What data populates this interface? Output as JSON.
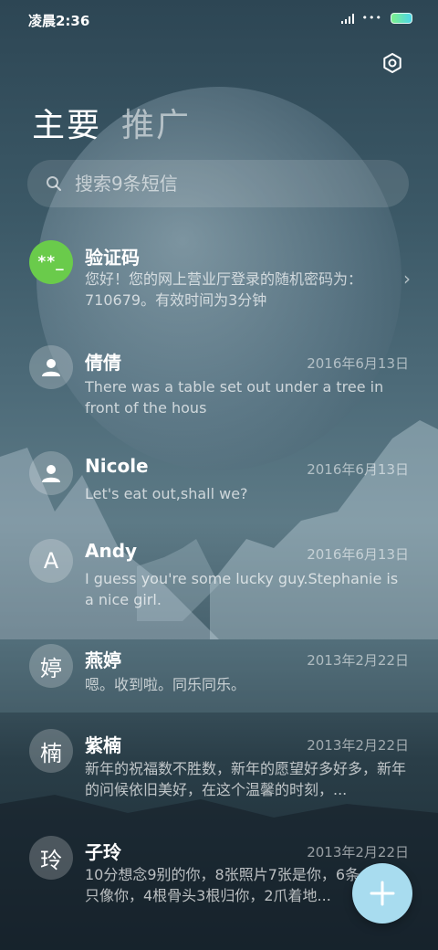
{
  "status_bar": {
    "time": "凌晨2:36",
    "wifi": "•••"
  },
  "header": {
    "settings_icon": "settings-gear-icon"
  },
  "tabs": [
    {
      "label": "主要",
      "active": true
    },
    {
      "label": "推广",
      "active": false
    }
  ],
  "search": {
    "placeholder": "搜索9条短信",
    "value": ""
  },
  "conversations": [
    {
      "name": "验证码",
      "avatar": "**_",
      "avatar_color": "#6acb4b",
      "date": "",
      "preview": "您好！您的网上营业厅登录的随机密码为：710679。有效时间为3分钟",
      "has_chevron": true
    },
    {
      "name": "倩倩",
      "avatar_icon": "person-icon",
      "date": "2016年6月13日",
      "preview": "There was a table set out under a tree in front of the hous"
    },
    {
      "name": "Nicole",
      "avatar_icon": "person-icon",
      "date": "2016年6月13日",
      "preview": "Let's eat out,shall we?"
    },
    {
      "name": "Andy",
      "avatar": "A",
      "date": "2016年6月13日",
      "preview": "I guess you're some lucky guy.Stephanie is a nice girl."
    },
    {
      "name": "燕婷",
      "avatar": "婷",
      "date": "2013年2月22日",
      "preview": "嗯。收到啦。同乐同乐。"
    },
    {
      "name": "紫楠",
      "avatar": "楠",
      "date": "2013年2月22日",
      "preview": "新年的祝福数不胜数，新年的愿望好多好多，新年的问候依旧美好，在这个温馨的时刻，..."
    },
    {
      "name": "子玲",
      "avatar": "玲",
      "date": "2013年2月22日",
      "preview": "10分想念9别的你，8张照片7张是你，6条小狗5只像你，4根骨头3根归你，2爪着地..."
    }
  ],
  "fab": {
    "icon": "plus-icon",
    "color": "#a8dcef"
  }
}
